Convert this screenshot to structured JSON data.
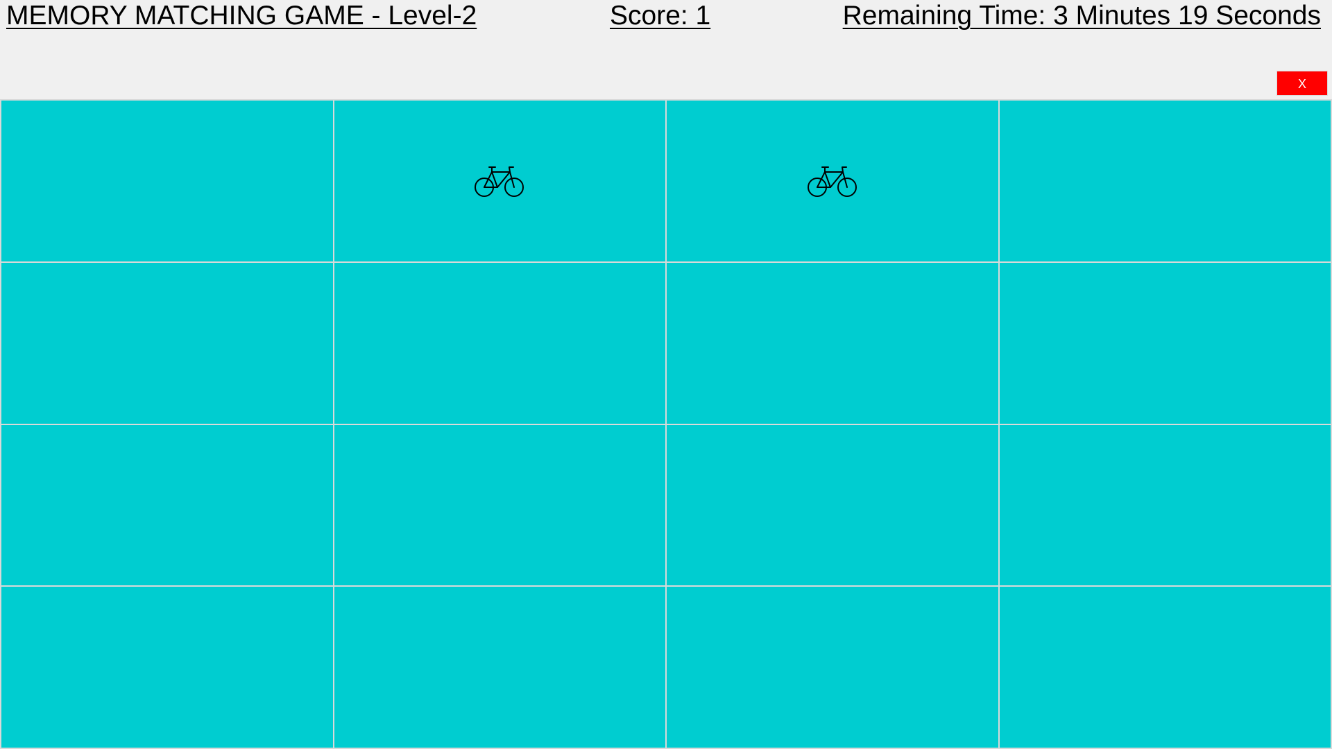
{
  "game": {
    "title": "MEMORY MATCHING GAME - Level-2",
    "score_text": "Score: 1",
    "timer_text": "Remaining Time: 3 Minutes 19 Seconds",
    "close_label": "X"
  },
  "colors": {
    "background": "#f0f0f0",
    "card_back": "#00cdd0",
    "grid_line": "#d9d9d9",
    "close_button": "#ff0000"
  },
  "board": {
    "rows": 4,
    "columns": 4,
    "cards": [
      {
        "state": "hidden",
        "icon": ""
      },
      {
        "state": "revealed",
        "icon": "bicycle-icon"
      },
      {
        "state": "revealed",
        "icon": "bicycle-icon"
      },
      {
        "state": "hidden",
        "icon": ""
      },
      {
        "state": "hidden",
        "icon": ""
      },
      {
        "state": "hidden",
        "icon": ""
      },
      {
        "state": "hidden",
        "icon": ""
      },
      {
        "state": "hidden",
        "icon": ""
      },
      {
        "state": "hidden",
        "icon": ""
      },
      {
        "state": "hidden",
        "icon": ""
      },
      {
        "state": "hidden",
        "icon": ""
      },
      {
        "state": "hidden",
        "icon": ""
      },
      {
        "state": "hidden",
        "icon": ""
      },
      {
        "state": "hidden",
        "icon": ""
      },
      {
        "state": "hidden",
        "icon": ""
      },
      {
        "state": "hidden",
        "icon": ""
      }
    ]
  }
}
